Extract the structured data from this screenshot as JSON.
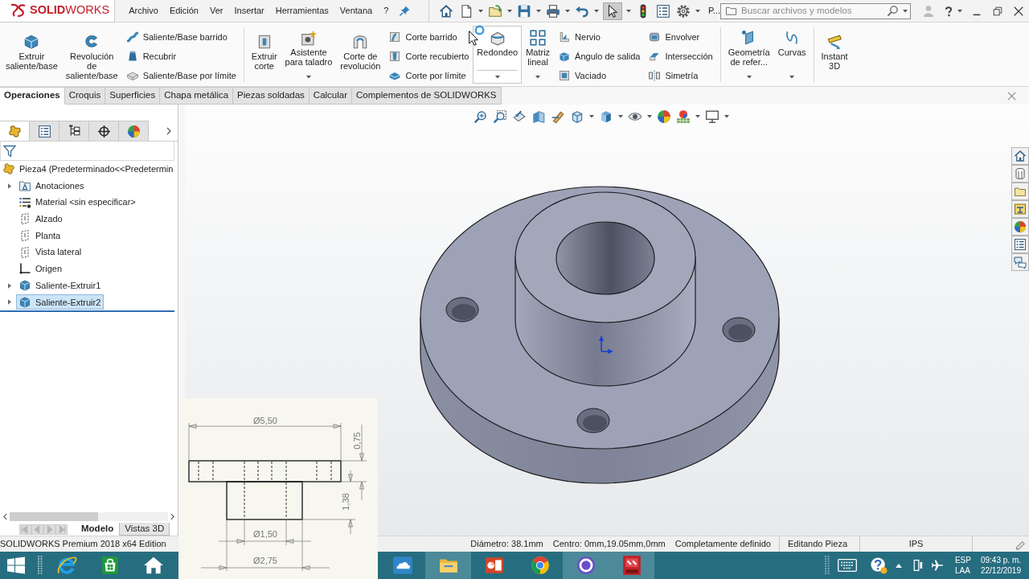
{
  "logo": {
    "text": "**SOLID**WORKS"
  },
  "menu": [
    "Archivo",
    "Edición",
    "Ver",
    "Insertar",
    "Herramientas",
    "Ventana",
    "?"
  ],
  "quick_access": [
    {
      "kind": "home",
      "dropdown": false,
      "pressed": false
    },
    {
      "kind": "new",
      "dropdown": true,
      "pressed": false
    },
    {
      "kind": "open",
      "dropdown": true,
      "pressed": false
    },
    {
      "kind": "save",
      "dropdown": true,
      "pressed": false
    },
    {
      "kind": "print",
      "dropdown": true,
      "pressed": false
    },
    {
      "kind": "undo",
      "dropdown": true,
      "pressed": false
    },
    {
      "kind": "select",
      "dropdown": true,
      "pressed": true
    },
    {
      "kind": "rebuild",
      "dropdown": false,
      "pressed": false
    },
    {
      "kind": "properties",
      "dropdown": false,
      "pressed": false
    },
    {
      "kind": "options",
      "dropdown": true,
      "pressed": false
    }
  ],
  "quick_access_more": "P...",
  "search": {
    "placeholder": "Buscar archivos y modelos"
  },
  "ribbon": [
    {
      "columns": [
        {
          "kind": "extrude",
          "lines": [
            "Extruir",
            "saliente/base"
          ],
          "dropdown": false,
          "highlighted": false
        },
        {
          "kind": "revolve",
          "lines": [
            "Revolución",
            "de",
            "saliente/base"
          ],
          "dropdown": false,
          "highlighted": false
        },
        {
          "stack": [
            {
              "kind": "sweep",
              "label": "Saliente/Base barrido"
            },
            {
              "kind": "loft",
              "label": "Recubrir"
            },
            {
              "kind": "boundary",
              "label": "Saliente/Base por límite"
            }
          ]
        }
      ]
    },
    {
      "columns": [
        {
          "kind": "cut",
          "lines": [
            "Extruir",
            "corte"
          ],
          "dropdown": false,
          "highlighted": false
        },
        {
          "kind": "hole",
          "lines": [
            "Asistente",
            "para taladro"
          ],
          "dropdown": true,
          "highlighted": false
        },
        {
          "kind": "revolvecut",
          "lines": [
            "Corte de",
            "revolución"
          ],
          "dropdown": false,
          "highlighted": false
        },
        {
          "stack": [
            {
              "kind": "sweepcut",
              "label": "Corte barrido"
            },
            {
              "kind": "loftcut",
              "label": "Corte recubierto"
            },
            {
              "kind": "boundarycut",
              "label": "Corte por límite"
            }
          ]
        },
        {
          "kind": "fillet",
          "lines": [
            "Redondeo"
          ],
          "dropdown": true,
          "highlighted": true
        },
        {
          "kind": "pattern",
          "lines": [
            "Matriz",
            "lineal"
          ],
          "dropdown": true,
          "highlighted": false
        },
        {
          "stack": [
            {
              "kind": "rib",
              "label": "Nervio"
            },
            {
              "kind": "draft",
              "label": "Ángulo de salida"
            },
            {
              "kind": "shell",
              "label": "Vaciado"
            }
          ]
        },
        {
          "stack": [
            {
              "kind": "wrap",
              "label": "Envolver"
            },
            {
              "kind": "intersect",
              "label": "Intersección"
            },
            {
              "kind": "mirror",
              "label": "Simetría"
            }
          ]
        }
      ]
    },
    {
      "columns": [
        {
          "kind": "reference",
          "lines": [
            "Geometría",
            "de refer..."
          ],
          "dropdown": true,
          "highlighted": false
        },
        {
          "kind": "curves",
          "lines": [
            "Curvas"
          ],
          "dropdown": true,
          "highlighted": false
        }
      ]
    },
    {
      "columns": [
        {
          "kind": "instant",
          "lines": [
            "Instant",
            "3D"
          ],
          "dropdown": false,
          "highlighted": false
        }
      ]
    }
  ],
  "command_tabs": [
    {
      "label": "Operaciones",
      "selected": true
    },
    {
      "label": "Croquis",
      "selected": false
    },
    {
      "label": "Superficies",
      "selected": false
    },
    {
      "label": "Chapa metálica",
      "selected": false
    },
    {
      "label": "Piezas soldadas",
      "selected": false
    },
    {
      "label": "Calcular",
      "selected": false
    },
    {
      "label": "Complementos de SOLIDWORKS",
      "selected": false
    }
  ],
  "feature_manager": {
    "tabs": [
      {
        "kind": "features",
        "selected": true
      },
      {
        "kind": "properties",
        "selected": false
      },
      {
        "kind": "configurations",
        "selected": false
      },
      {
        "kind": "dimxpert",
        "selected": false
      },
      {
        "kind": "display",
        "selected": false
      }
    ],
    "tree": [
      {
        "kind": "part",
        "label": "Pieza4 (Predeterminado<<Predetermin",
        "children": [
          {
            "kind": "annotations",
            "label": "Anotaciones",
            "expandable": true,
            "selected": false
          },
          {
            "kind": "material",
            "label": "Material <sin especificar>",
            "expandable": false,
            "selected": false
          },
          {
            "kind": "plane",
            "label": "Alzado",
            "expandable": false,
            "selected": false
          },
          {
            "kind": "plane",
            "label": "Planta",
            "expandable": false,
            "selected": false
          },
          {
            "kind": "plane",
            "label": "Vista lateral",
            "expandable": false,
            "selected": false
          },
          {
            "kind": "origin",
            "label": "Origen",
            "expandable": false,
            "selected": false
          },
          {
            "kind": "extrude",
            "label": "Saliente-Extruir1",
            "expandable": true,
            "selected": false
          },
          {
            "kind": "extrude",
            "label": "Saliente-Extruir2",
            "expandable": true,
            "selected": true
          }
        ]
      }
    ],
    "bottom_tabs": [
      {
        "label": "Modelo",
        "selected": true
      },
      {
        "label": "Vistas 3D",
        "selected": false
      }
    ]
  },
  "reference_drawing": {
    "labels": [
      "Ø5,50",
      "0,75",
      "1,38",
      "Ø1,50",
      "Ø2,75"
    ]
  },
  "status_bar": {
    "product": "SOLIDWORKS Premium 2018 x64 Edition",
    "sections": [
      [
        "Diámetro: 38.1mm",
        "Centro: 0mm,19.05mm,0mm",
        "Completamente definido"
      ],
      [
        "Editando Pieza"
      ],
      [
        "IPS"
      ]
    ]
  },
  "taskbar": {
    "apps_left": [
      {
        "kind": "browser",
        "highlighted": false
      },
      {
        "kind": "store",
        "highlighted": false
      },
      {
        "kind": "home",
        "highlighted": false
      }
    ],
    "apps_right": [
      {
        "kind": "cloud",
        "highlighted": false
      },
      {
        "kind": "explorer",
        "highlighted": true
      },
      {
        "kind": "slides",
        "highlighted": false
      },
      {
        "kind": "chrome",
        "highlighted": false
      },
      {
        "kind": "assistant",
        "highlighted": true
      },
      {
        "kind": "cad",
        "highlighted": true
      }
    ],
    "tray": {
      "language": [
        "ESP",
        "LAA"
      ],
      "time": "09:43 p. m.",
      "date": "22/12/2019"
    }
  }
}
